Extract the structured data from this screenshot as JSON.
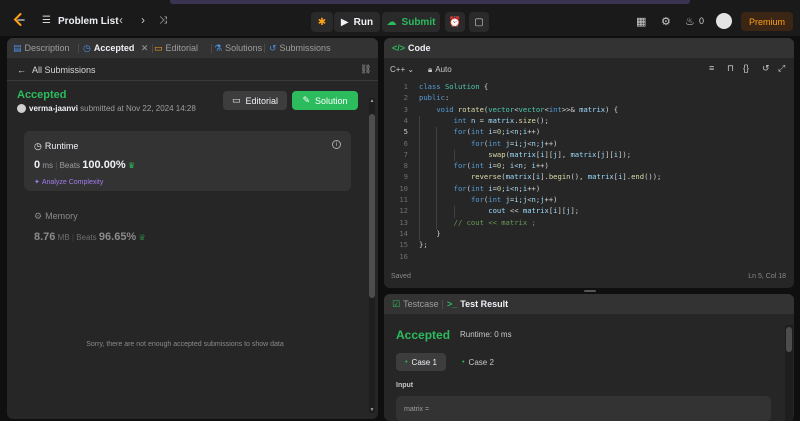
{
  "topbar": {
    "problem_list": "Problem List",
    "run": "Run",
    "submit": "Submit",
    "streak": "0",
    "premium": "Premium",
    "colors": {
      "accent": "#ffa116",
      "success": "#2cbb5d",
      "background": "#1a1a1a"
    }
  },
  "left_tabs": [
    {
      "label": "Description",
      "icon": "document-icon"
    },
    {
      "label": "Accepted",
      "icon": "clock-icon"
    },
    {
      "label": "Editorial",
      "icon": "book-icon"
    },
    {
      "label": "Solutions",
      "icon": "flask-icon"
    },
    {
      "label": "Submissions",
      "icon": "history-icon"
    }
  ],
  "submission": {
    "back_label": "All Submissions",
    "status": "Accepted",
    "username": "verma-jaanvi",
    "submitted_text": "submitted at Nov 22, 2024 14:28",
    "editorial_button": "Editorial",
    "solution_button": "Solution",
    "runtime": {
      "title": "Runtime",
      "value": "0",
      "unit": "ms",
      "beats_label": "Beats",
      "beats_value": "100.00%",
      "analyze": "Analyze Complexity"
    },
    "memory": {
      "title": "Memory",
      "value": "8.76",
      "unit": "MB",
      "beats_label": "Beats",
      "beats_value": "96.65%"
    },
    "empty_message": "Sorry, there are not enough accepted submissions to show data"
  },
  "editor": {
    "title": "Code",
    "language": "C++",
    "mode": "Auto",
    "saved": "Saved",
    "cursor": "Ln 5, Col 18",
    "current_line": 5,
    "lines": [
      "class Solution {",
      "public:",
      "    void rotate(vector<vector<int>>& matrix) {",
      "        int n = matrix.size();",
      "        for(int i=0;i<n;i++)",
      "            for(int j=i;j<n;j++)",
      "                swap(matrix[i][j], matrix[j][i]);",
      "        for(int i=0; i<n; i++)",
      "            reverse(matrix[i].begin(), matrix[i].end());",
      "        for(int i=0;i<n;i++)",
      "            for(int j=i;j<n;j++)",
      "                cout << matrix[i][j];",
      "        // cout << matrix ;",
      "    }",
      "};",
      ""
    ]
  },
  "testcase": {
    "tab_testcase": "Testcase",
    "tab_result": "Test Result",
    "status": "Accepted",
    "runtime": "Runtime: 0 ms",
    "cases": [
      "Case 1",
      "Case 2"
    ],
    "input_label": "Input",
    "input_var": "matrix ="
  }
}
